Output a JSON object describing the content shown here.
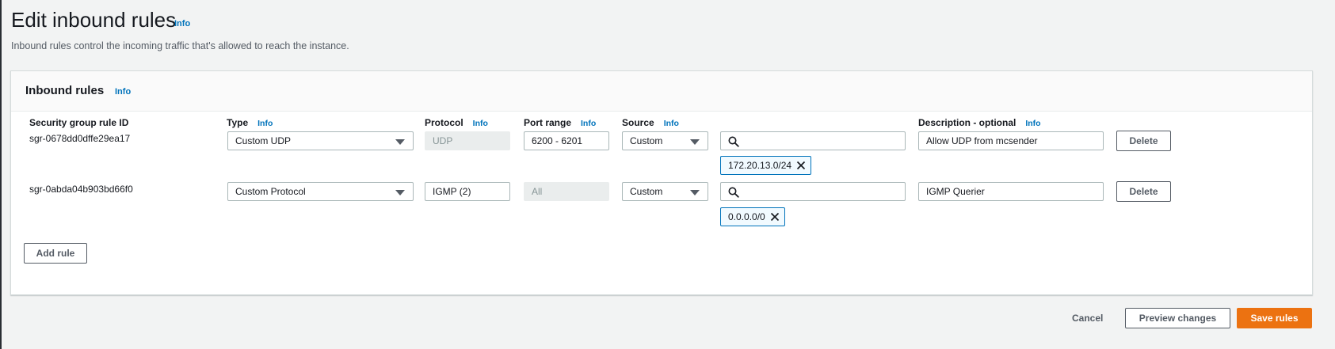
{
  "page": {
    "title": "Edit inbound rules",
    "info_label": "Info",
    "description": "Inbound rules control the incoming traffic that's allowed to reach the instance."
  },
  "panel": {
    "title": "Inbound rules",
    "info_label": "Info"
  },
  "columns": {
    "rule_id": "Security group rule ID",
    "type": "Type",
    "protocol": "Protocol",
    "port_range": "Port range",
    "source": "Source",
    "description": "Description - optional",
    "info_label": "Info"
  },
  "rules": [
    {
      "id": "sgr-0678dd0dffe29ea17",
      "type": "Custom UDP",
      "protocol": "UDP",
      "port_range": "6200 - 6201",
      "source": "Custom",
      "search_value": "",
      "cidr": "172.20.13.0/24",
      "description": "Allow UDP from mcsender",
      "delete_label": "Delete"
    },
    {
      "id": "sgr-0abda04b903bd66f0",
      "type": "Custom Protocol",
      "protocol": "IGMP (2)",
      "port_range": "All",
      "source": "Custom",
      "search_value": "",
      "cidr": "0.0.0.0/0",
      "description": "IGMP Querier",
      "delete_label": "Delete"
    }
  ],
  "actions": {
    "add_rule": "Add rule",
    "cancel": "Cancel",
    "preview": "Preview changes",
    "save": "Save rules"
  },
  "colors": {
    "accent": "#ec7211",
    "link": "#0073bb",
    "token_border": "#0073bb"
  }
}
